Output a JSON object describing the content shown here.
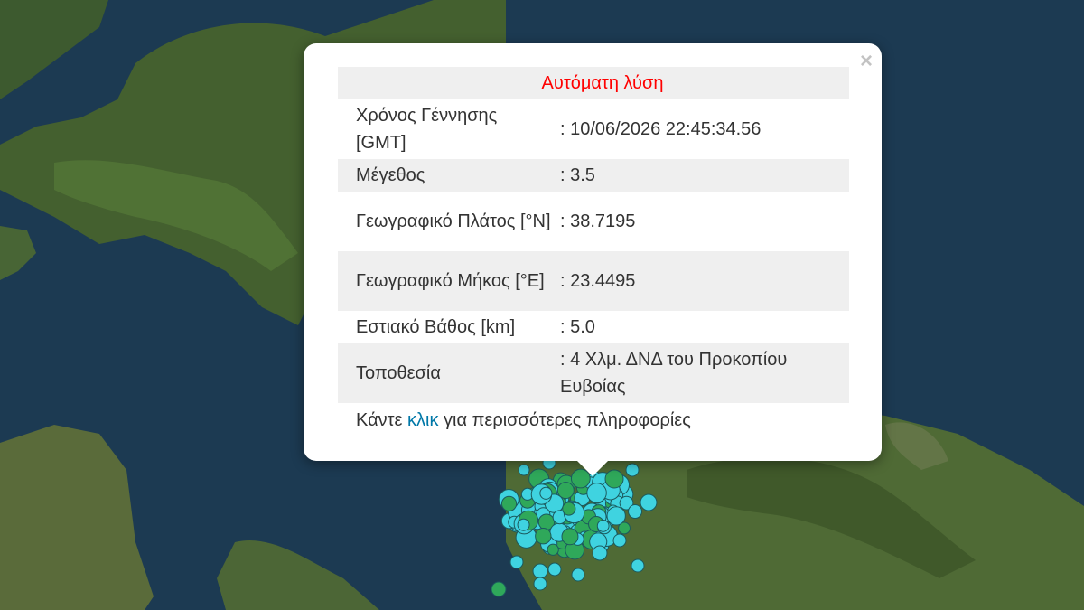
{
  "popup": {
    "close": "×",
    "title": "Αυτόματη λύση",
    "rows": [
      {
        "label": "Χρόνος Γέννησης [GMT]",
        "value": ": 10/06/2026 22:45:34.56"
      },
      {
        "label": "Μέγεθος",
        "value": ": 3.5"
      },
      {
        "label": "Γεωγραφικό Πλάτος [°N]",
        "value": ": 38.7195"
      },
      {
        "label": "Γεωγραφικό Μήκος [°E]",
        "value": ": 23.4495"
      },
      {
        "label": "Εστιακό Βάθος [km]",
        "value": ": 5.0"
      },
      {
        "label": "Τοποθεσία",
        "value": ": 4 Χλμ. ΔΝΔ του Προκοπίου Ευβοίας"
      }
    ],
    "footer_prefix": "Κάντε ",
    "footer_link": "κλικ",
    "footer_suffix": " για περισσότερες πληροφορίες"
  },
  "colors": {
    "sea": "#1c3a52",
    "land": "#3f5c2c",
    "marker_cyan": "#3fd3e0",
    "marker_green": "#2fa85a",
    "title_red": "#ff0000",
    "link": "#0078a8"
  }
}
